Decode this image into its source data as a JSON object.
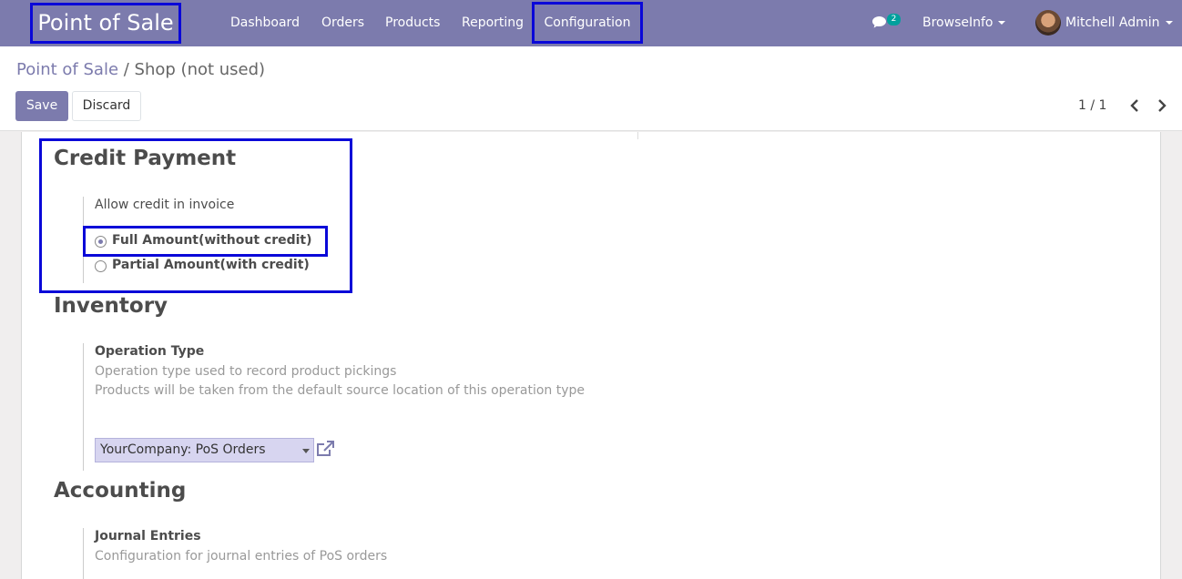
{
  "navbar": {
    "brand": "Point of Sale",
    "menu": [
      "Dashboard",
      "Orders",
      "Products",
      "Reporting"
    ],
    "config": "Configuration",
    "chat_count": "2",
    "company": "BrowseInfo",
    "user": "Mitchell Admin",
    "accent": "#7c7bad"
  },
  "breadcrumb": {
    "parent": "Point of Sale",
    "sep": " / ",
    "current": "Shop (not used)"
  },
  "buttons": {
    "save": "Save",
    "discard": "Discard"
  },
  "pager": {
    "value": "1 / 1"
  },
  "credit": {
    "title": "Credit Payment",
    "field_label": "Allow credit in invoice",
    "options": [
      {
        "label": "Full Amount(without credit)",
        "checked": true
      },
      {
        "label": "Partial Amount(with credit)",
        "checked": false
      }
    ]
  },
  "inventory": {
    "title": "Inventory",
    "field_label": "Operation Type",
    "help1": "Operation type used to record product pickings",
    "help2": "Products will be taken from the default source location of this operation type",
    "select_value": "YourCompany: PoS Orders"
  },
  "accounting": {
    "title": "Accounting",
    "field_label": "Journal Entries",
    "help": "Configuration for journal entries of PoS orders"
  },
  "colors": {
    "highlight": "#0a08d8",
    "badge": "#00a09d"
  }
}
